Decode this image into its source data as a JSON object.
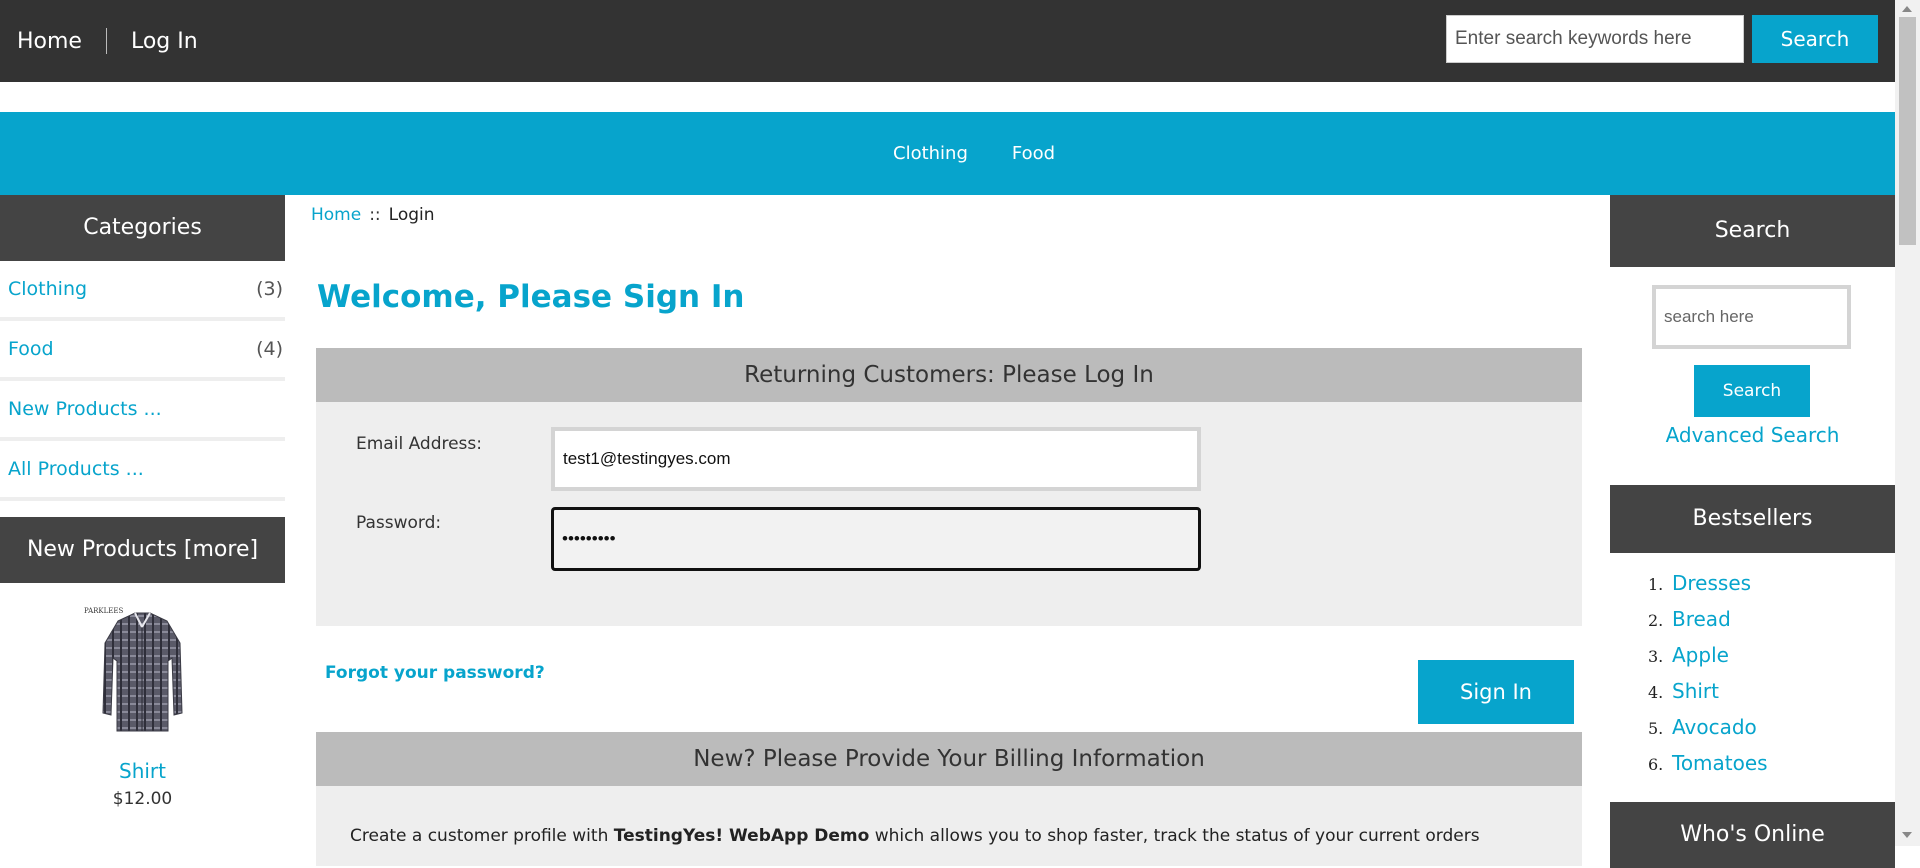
{
  "topnav": {
    "home": "Home",
    "login": "Log In"
  },
  "top_search": {
    "placeholder": "Enter search keywords here",
    "button": "Search"
  },
  "category_bar": {
    "items": [
      "Clothing",
      "Food"
    ]
  },
  "sidebar": {
    "categories_title": "Categories",
    "categories": [
      {
        "label": "Clothing",
        "count": "(3)"
      },
      {
        "label": "Food",
        "count": "(4)"
      },
      {
        "label": "New Products ...",
        "count": ""
      },
      {
        "label": "All Products ...",
        "count": ""
      }
    ],
    "new_products_title": "New Products  [more]",
    "new_product": {
      "brand_text": "PARKLEES",
      "name": "Shirt",
      "price": "$12.00"
    }
  },
  "breadcrumb": {
    "home": "Home",
    "separator": "::",
    "current": "Login"
  },
  "main": {
    "title": "Welcome, Please Sign In",
    "returning_heading": "Returning Customers: Please Log In",
    "email_label": "Email Address:",
    "email_value": "test1@testingyes.com",
    "password_label": "Password:",
    "password_value": "•••••••••",
    "forgot_link": "Forgot your password?",
    "signin_button": "Sign In",
    "new_heading": "New? Please Provide Your Billing Information",
    "new_text_1": "Create a customer profile with ",
    "new_text_bold": "TestingYes! WebApp Demo",
    "new_text_2": " which allows you to shop faster, track the status of your current orders"
  },
  "right_sidebar": {
    "search_title": "Search",
    "search_placeholder": "search here",
    "search_button": "Search",
    "advanced_search": "Advanced Search",
    "bestsellers_title": "Bestsellers",
    "bestsellers": [
      {
        "num": "1.",
        "name": "Dresses"
      },
      {
        "num": "2.",
        "name": "Bread"
      },
      {
        "num": "3.",
        "name": "Apple"
      },
      {
        "num": "4.",
        "name": "Shirt"
      },
      {
        "num": "5.",
        "name": "Avocado"
      },
      {
        "num": "6.",
        "name": "Tomatoes"
      }
    ],
    "whos_online_title": "Who's Online"
  },
  "colors": {
    "accent": "#07a4cc",
    "dark": "#333333",
    "box_head": "#444444",
    "panel_head": "#bbbbbb",
    "panel_body": "#eeeeee"
  },
  "icons": {
    "product_image": "shirt-image"
  }
}
